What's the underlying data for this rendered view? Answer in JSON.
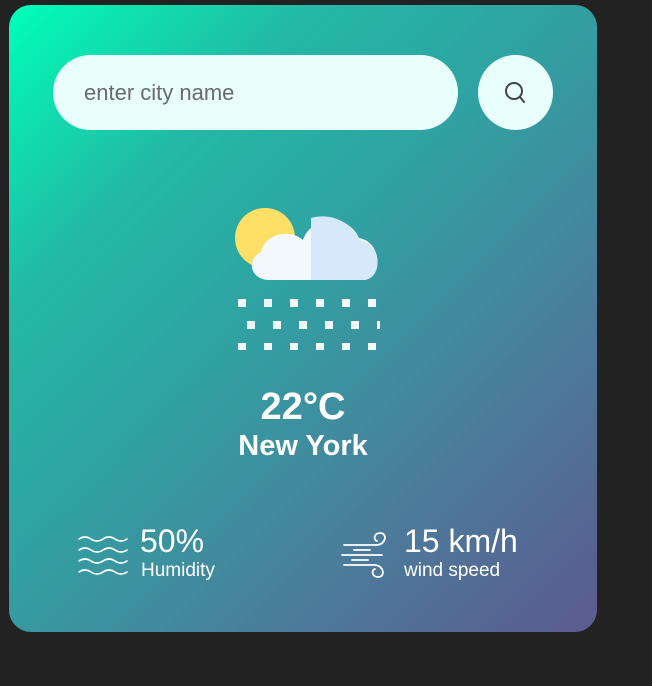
{
  "search": {
    "placeholder": "enter city name",
    "icon": "search-icon"
  },
  "weather": {
    "icon": "snow-cloud-sun-icon",
    "temperature": "22°C",
    "city": "New York"
  },
  "humidity": {
    "icon": "waves-icon",
    "value": "50%",
    "label": "Humidity"
  },
  "wind": {
    "icon": "wind-icon",
    "value": "15 km/h",
    "label": "wind speed"
  },
  "colors": {
    "page_background": "#222222",
    "gradient_start": "#00ffb8",
    "gradient_end": "#5c5a90",
    "input_background": "#e9fffb",
    "text": "#ffffff"
  }
}
